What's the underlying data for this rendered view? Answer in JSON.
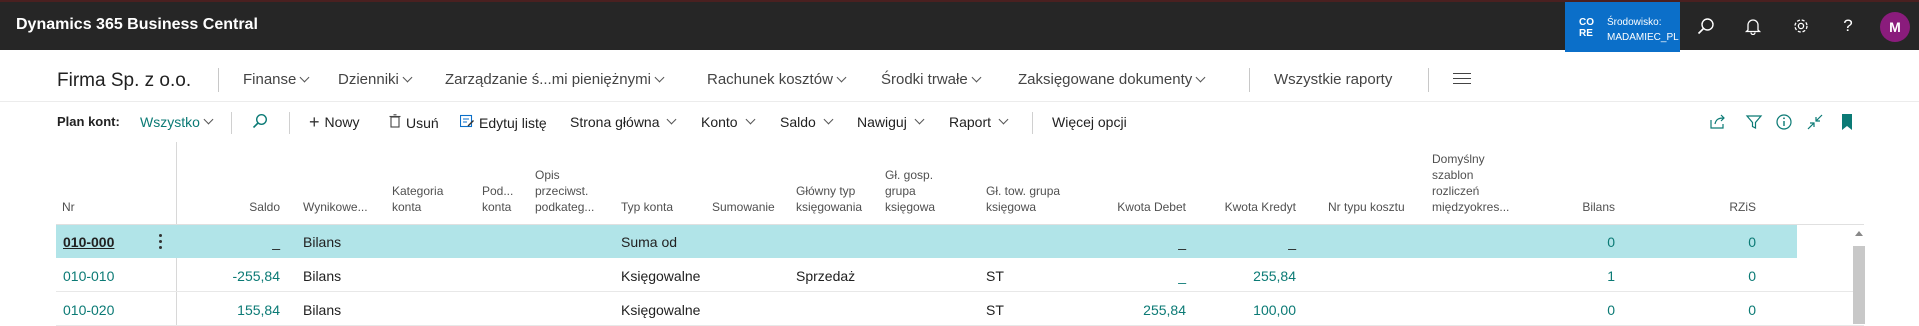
{
  "app": {
    "title": "Dynamics 365 Business Central",
    "env_code": "CO RE",
    "env_label": "Środowisko:",
    "env_name": "MADAMIEC_PL",
    "avatar_initial": "M"
  },
  "nav": {
    "company": "Firma Sp. z o.o.",
    "items": [
      "Finanse",
      "Dzienniki",
      "Zarządzanie ś...mi pieniężnymi",
      "Rachunek kosztów",
      "Środki trwałe",
      "Zaksięgowane dokumenty"
    ],
    "all_reports": "Wszystkie raporty"
  },
  "actionbar": {
    "page_label": "Plan kont:",
    "filter_value": "Wszystko",
    "new": "Nowy",
    "delete": "Usuń",
    "edit_list": "Edytuj listę",
    "home": "Strona główna",
    "account": "Konto",
    "balance": "Saldo",
    "navigate": "Nawiguj",
    "report": "Raport",
    "more": "Więcej opcji"
  },
  "columns": {
    "nr": "Nr",
    "saldo": "Saldo",
    "wynikowe": "Wynikowe...",
    "kategoria": "Kategoria konta",
    "podkonta": "Pod... konta",
    "opis": "Opis przeciwst. podkateg...",
    "typ": "Typ konta",
    "sumowanie": "Sumowanie",
    "glowny_typ": "Główny typ księgowania",
    "gl_gosp": "Gł. gosp. grupa księgowa",
    "gl_tow": "Gł. tow. grupa księgowa",
    "debet": "Kwota Debet",
    "kredyt": "Kwota Kredyt",
    "nr_typu": "Nr typu kosztu",
    "szablon": "Domyślny szablon rozliczeń międzyokres...",
    "bilans": "Bilans",
    "rzis": "RZiS"
  },
  "rows": [
    {
      "nr": "010-000",
      "saldo": "_",
      "wynikowe": "Bilans",
      "typ": "Suma od",
      "glowny_typ": "",
      "gl_tow": "",
      "debet": "_",
      "kredyt": "_",
      "bilans": "0",
      "rzis": "0"
    },
    {
      "nr": "010-010",
      "saldo": "-255,84",
      "wynikowe": "Bilans",
      "typ": "Księgowalne",
      "glowny_typ": "Sprzedaż",
      "gl_tow": "ST",
      "debet": "_",
      "kredyt": "255,84",
      "bilans": "1",
      "rzis": "0"
    },
    {
      "nr": "010-020",
      "saldo": "155,84",
      "wynikowe": "Bilans",
      "typ": "Księgowalne",
      "glowny_typ": "",
      "gl_tow": "ST",
      "debet": "255,84",
      "kredyt": "100,00",
      "bilans": "0",
      "rzis": "0"
    }
  ],
  "colors": {
    "appbar": "#262626",
    "env": "#0b6fc9",
    "selected_row": "#b1e4e8",
    "accent": "#0b7a75",
    "avatar": "#8a1c7c"
  }
}
